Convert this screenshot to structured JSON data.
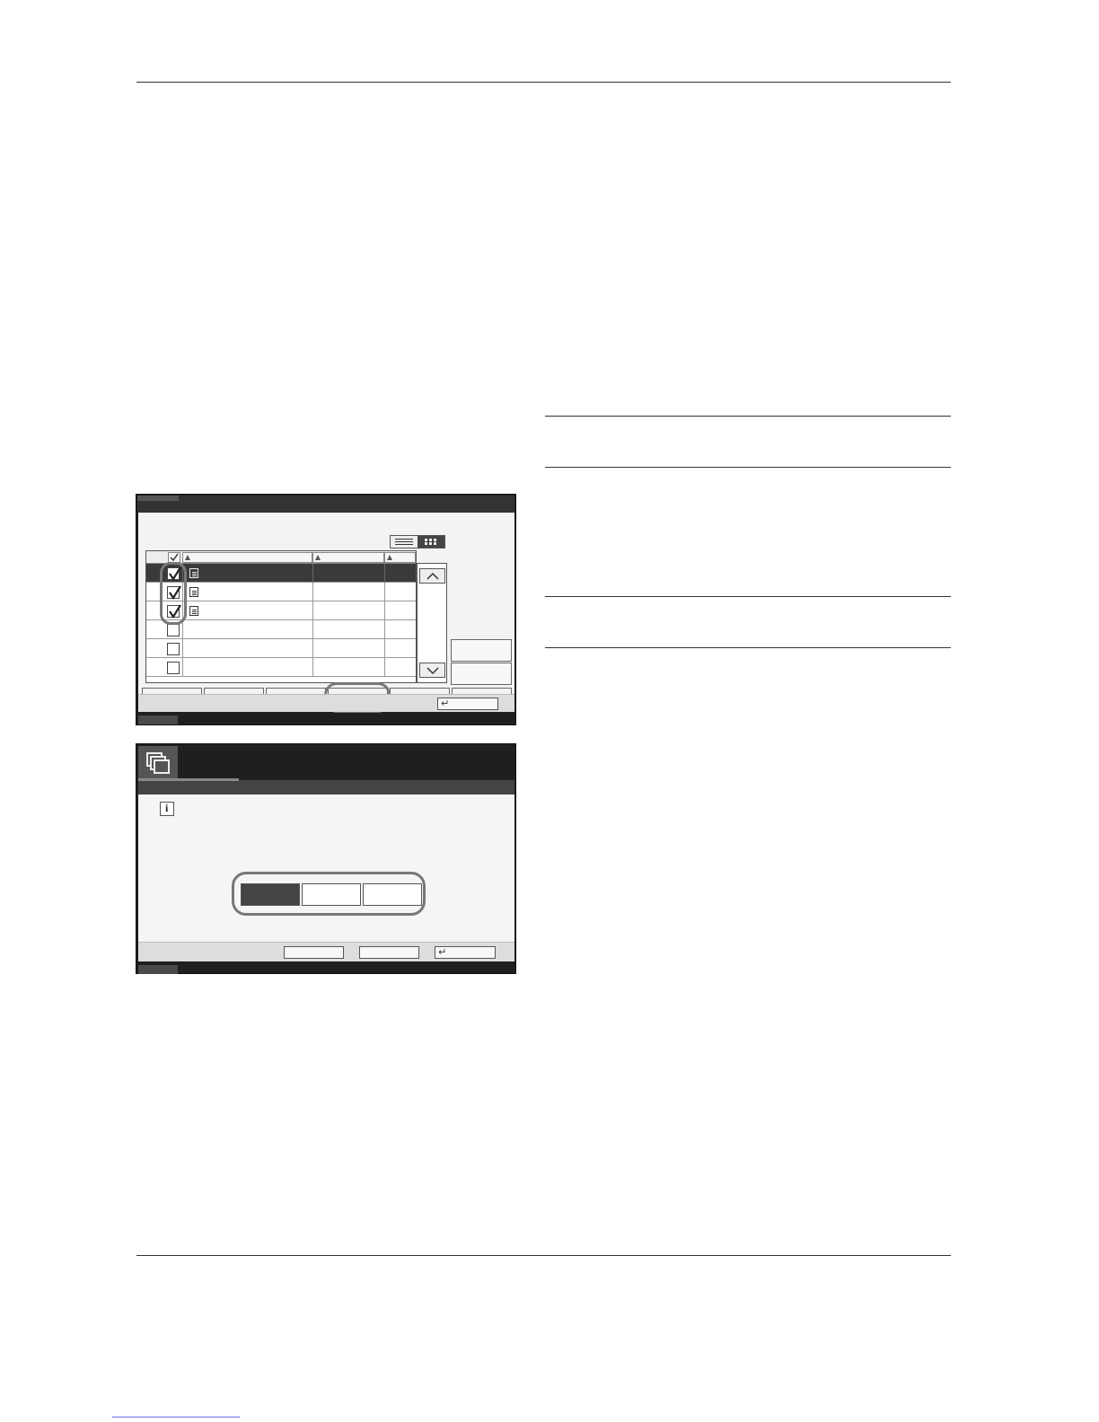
{
  "screen1": {
    "rows": [
      {
        "checked": true,
        "selected": true,
        "has_doc": true
      },
      {
        "checked": true,
        "selected": false,
        "has_doc": true
      },
      {
        "checked": true,
        "selected": false,
        "has_doc": true
      },
      {
        "checked": false,
        "selected": false,
        "has_doc": false
      },
      {
        "checked": false,
        "selected": false,
        "has_doc": false
      },
      {
        "checked": false,
        "selected": false,
        "has_doc": false
      }
    ],
    "enter_symbol": "↵"
  },
  "screen2": {
    "info_symbol": "i",
    "enter_symbol": "↵"
  },
  "colors": {
    "screen_frame": "#1f1f1f",
    "panel": "#f3f3f3",
    "selected_row": "#3a3a3a",
    "highlight_ring": "#777777",
    "footer_link": "#6a6af0"
  }
}
